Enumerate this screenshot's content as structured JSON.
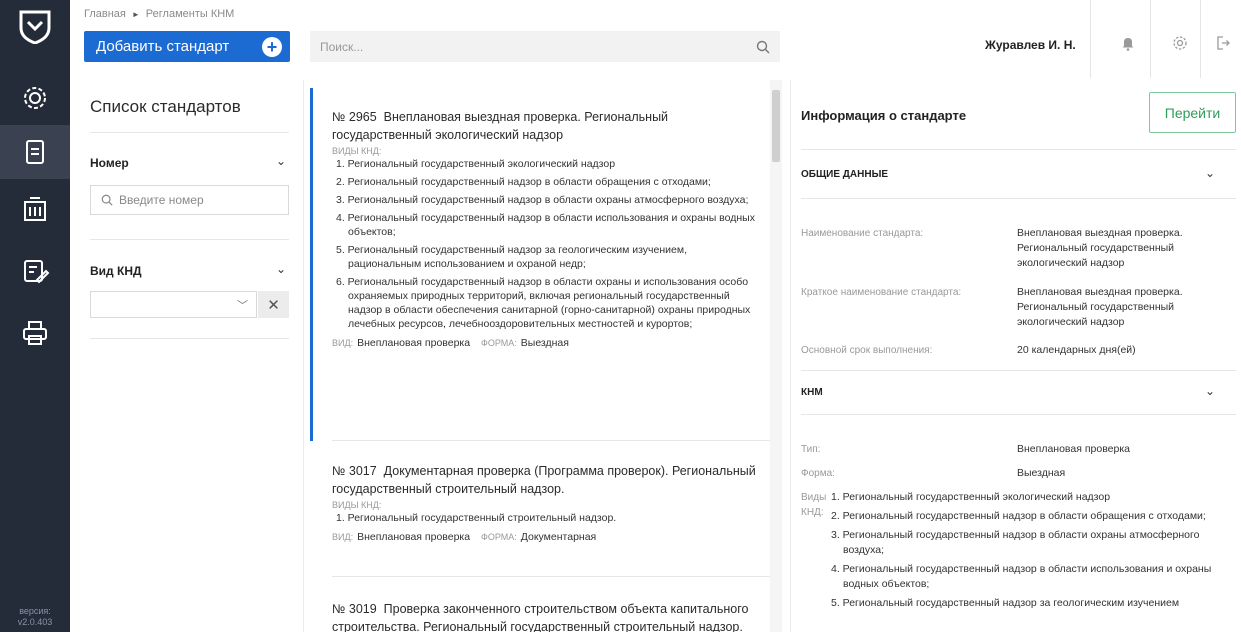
{
  "app": {
    "version_label": "версия:",
    "version": "v2.0.403"
  },
  "header": {
    "breadcrumbs": [
      "Главная",
      "Регламенты КНМ"
    ],
    "add_button": "Добавить стандарт",
    "search_placeholder": "Поиск...",
    "user_name": "Журавлев И. Н."
  },
  "filters": {
    "title": "Список стандартов",
    "number_label": "Номер",
    "number_placeholder": "Введите номер",
    "knd_label": "Вид КНД",
    "knd_value": ""
  },
  "list": [
    {
      "number": "№ 2965",
      "title": "Внеплановая выездная проверка. Региональный государственный экологический надзор",
      "kinds_caption": "ВИДЫ КНД:",
      "kinds": [
        "1. Региональный государственный экологический надзор",
        "2. Региональный государственный надзор в области обращения с отходами;",
        "3. Региональный государственный надзор в области охраны атмосферного воздуха;",
        "4. Региональный государственный надзор в области использования и охраны водных объектов;",
        "5. Региональный государственный надзор за геологическим изучением, рациональным использованием и охраной недр;",
        "6. Региональный государственный надзор в области охраны и использования особо охраняемых природных территорий, включая региональный государственный надзор в области обеспечения санитарной (горно-санитарной) охраны природных лечебных ресурсов, лечебнооздоровительных местностей и курортов;"
      ],
      "type_caption": "ВИД:",
      "type": "Внеплановая проверка",
      "form_caption": "ФОРМА:",
      "form": "Выездная"
    },
    {
      "number": "№ 3017",
      "title": "Документарная проверка (Программа проверок). Региональный государственный строительный надзор.",
      "kinds_caption": "ВИДЫ КНД:",
      "kinds": [
        "1. Региональный государственный строительный надзор."
      ],
      "type_caption": "ВИД:",
      "type": "Внеплановая проверка",
      "form_caption": "ФОРМА:",
      "form": "Документарная"
    },
    {
      "number": "№ 3019",
      "title": "Проверка законченного строительством объекта капитального строительства. Региональный государственный строительный надзор."
    }
  ],
  "info": {
    "title": "Информация о стандарте",
    "go_button": "Перейти",
    "general_section": "ОБЩИЕ ДАННЫЕ",
    "name_label": "Наименование стандарта:",
    "name_value": "Внеплановая выездная проверка. Региональный государственный экологический надзор",
    "short_label": "Краткое наименование стандарта:",
    "short_value": "Внеплановая выездная проверка. Региональный государственный экологический надзор",
    "term_label": "Основной срок выполнения:",
    "term_value": "20 календарных дня(ей)",
    "knm_section": "КНМ",
    "type_label": "Тип:",
    "type_value": "Внеплановая проверка",
    "form_label": "Форма:",
    "form_value": "Выездная",
    "kinds_label": "Виды КНД:",
    "kinds": [
      "1. Региональный государственный экологический надзор",
      "2. Региональный государственный надзор в области обращения с отходами;",
      "3. Региональный государственный надзор в области охраны атмосферного воздуха;",
      "4. Региональный государственный надзор в области использования и охраны водных объектов;",
      "5. Региональный государственный надзор за геологическим изучением"
    ]
  },
  "colors": {
    "rail": "#252c39",
    "primary": "#1c6bd2",
    "go_button": "#2f9d5a"
  }
}
